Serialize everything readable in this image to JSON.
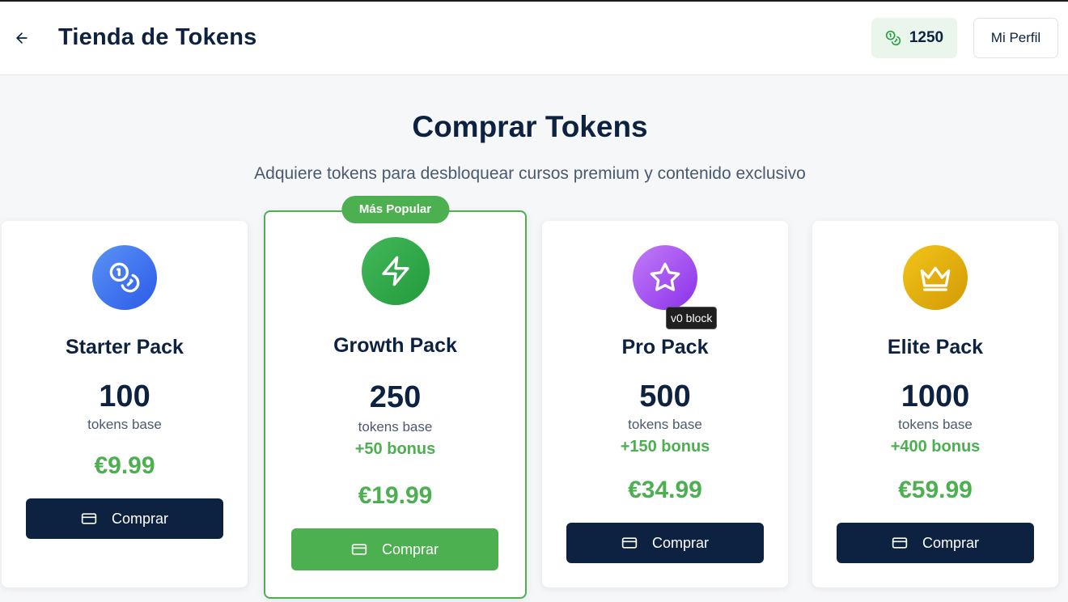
{
  "header": {
    "title": "Tienda de Tokens",
    "balance": "1250",
    "profile_label": "Mi Perfil"
  },
  "hero": {
    "title": "Comprar Tokens",
    "subtitle": "Adquiere tokens para desbloquear cursos premium y contenido exclusivo"
  },
  "packs": [
    {
      "name": "Starter Pack",
      "tokens": "100",
      "base_label": "tokens base",
      "bonus": "",
      "price": "€9.99",
      "buy_label": "Comprar",
      "icon": "coins-icon",
      "color": "#3f6ff0"
    },
    {
      "name": "Growth Pack",
      "tokens": "250",
      "base_label": "tokens base",
      "bonus": "+50 bonus",
      "price": "€19.99",
      "buy_label": "Comprar",
      "icon": "lightning-icon",
      "color": "#2e9e45",
      "badge": "Más Popular"
    },
    {
      "name": "Pro Pack",
      "tokens": "500",
      "base_label": "tokens base",
      "bonus": "+150 bonus",
      "price": "€34.99",
      "buy_label": "Comprar",
      "icon": "star-icon",
      "color": "#9a3ff0"
    },
    {
      "name": "Elite Pack",
      "tokens": "1000",
      "base_label": "tokens base",
      "bonus": "+400 bonus",
      "price": "€59.99",
      "buy_label": "Comprar",
      "icon": "crown-icon",
      "color": "#e3b00a"
    }
  ],
  "tooltip": "v0 block",
  "colors": {
    "accent": "#4caf50",
    "navy": "#0d2240",
    "balance_bg": "#eaf6ec"
  }
}
